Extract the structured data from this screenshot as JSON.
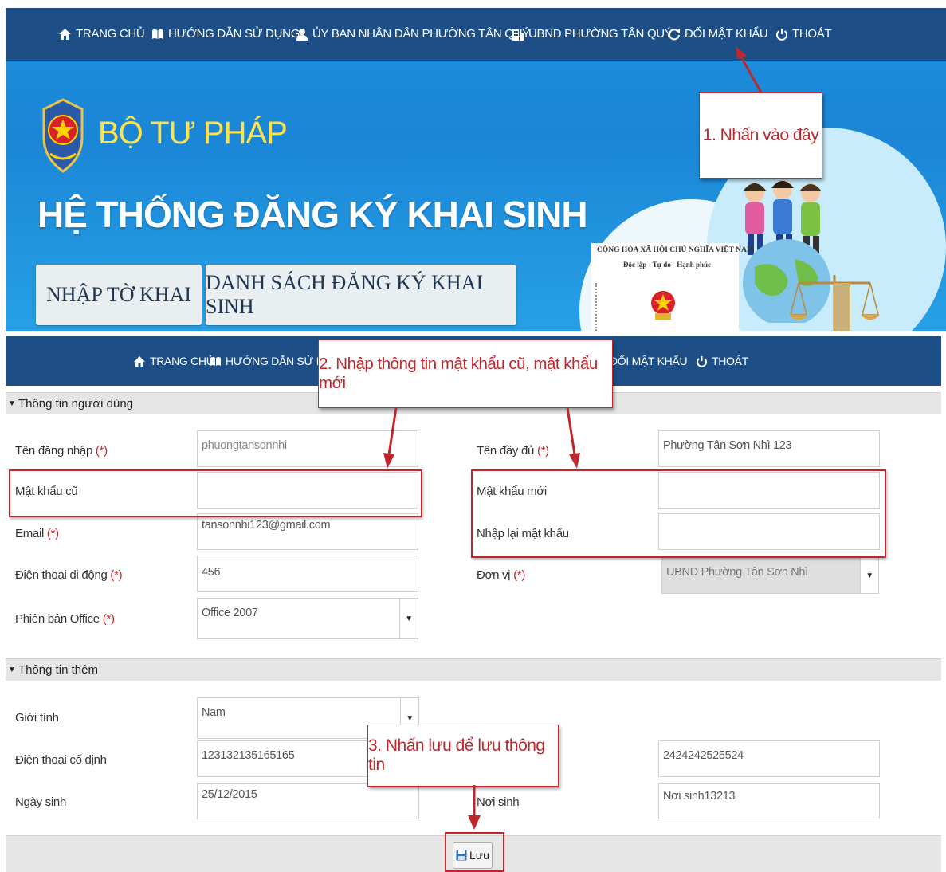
{
  "top_nav": {
    "home": "TRANG CHỦ",
    "guide": "HƯỚNG DẪN SỬ DỤNG",
    "committee": "ỦY BAN NHÂN DÂN PHƯỜNG TÂN QUÝ",
    "ubnd": "UBND PHƯỜNG TÂN QUÝ",
    "change_password": "ĐỔI MẬT KHẨU",
    "logout": "THOÁT"
  },
  "banner": {
    "ministry": "BỘ TƯ PHÁP",
    "system_title": "HỆ THỐNG ĐĂNG KÝ KHAI SINH",
    "enter_declaration": "NHẬP TỜ KHAI",
    "registration_list": "DANH SÁCH ĐĂNG KÝ KHAI SINH",
    "doc_header": "CỘNG HÒA XÃ HỘI CHỦ NGHĨA VIỆT NAM",
    "doc_motto": "Độc lập - Tự do - Hạnh phúc"
  },
  "callouts": {
    "step1": "1. Nhấn vào đây",
    "step2": "2. Nhập thông tin mật khẩu cũ, mật khẩu mới",
    "step3": "3. Nhấn lưu để lưu thông tin"
  },
  "bottom_nav": {
    "home": "TRANG CHỦ",
    "guide": "HƯỚNG DẪN SỬ DỤNG",
    "change_password": "ĐỔI MẬT KHẨU",
    "logout": "THOÁT"
  },
  "user_info": {
    "section_title": "Thông tin người dùng",
    "username_label": "Tên đăng nhập",
    "username_value": "phuongtansonnhi",
    "old_password_label": "Mật khẩu cũ",
    "email_label": "Email",
    "email_value": "tansonnhi123@gmail.com",
    "mobile_label": "Điện thoại di động",
    "mobile_value": "456",
    "office_label": "Phiên bản Office",
    "office_value": "Office 2007",
    "fullname_label": "Tên đầy đủ",
    "fullname_value": "Phường Tân Sơn Nhì 123",
    "new_password_label": "Mật khẩu mới",
    "confirm_password_label": "Nhập lại mật khẩu",
    "unit_label": "Đơn vị",
    "unit_value": "UBND Phường Tân Sơn Nhì",
    "required_mark": "(*)"
  },
  "extra_info": {
    "section_title": "Thông tin thêm",
    "gender_label": "Giới tính",
    "gender_value": "Nam",
    "landline_label": "Điện thoại cố định",
    "landline_value": "123132135165165",
    "right_field_value": "2424242525524",
    "dob_label": "Ngày sinh",
    "dob_value": "25/12/2015",
    "birthplace_label": "Nơi sinh",
    "birthplace_value": "Nơi sinh13213"
  },
  "save_label": "Lưu",
  "colors": {
    "nav_bg": "#1d4f86",
    "banner_blue": "#1e8fdc",
    "ministry_yellow": "#ffe14a",
    "annotation_red": "#c0272d"
  }
}
